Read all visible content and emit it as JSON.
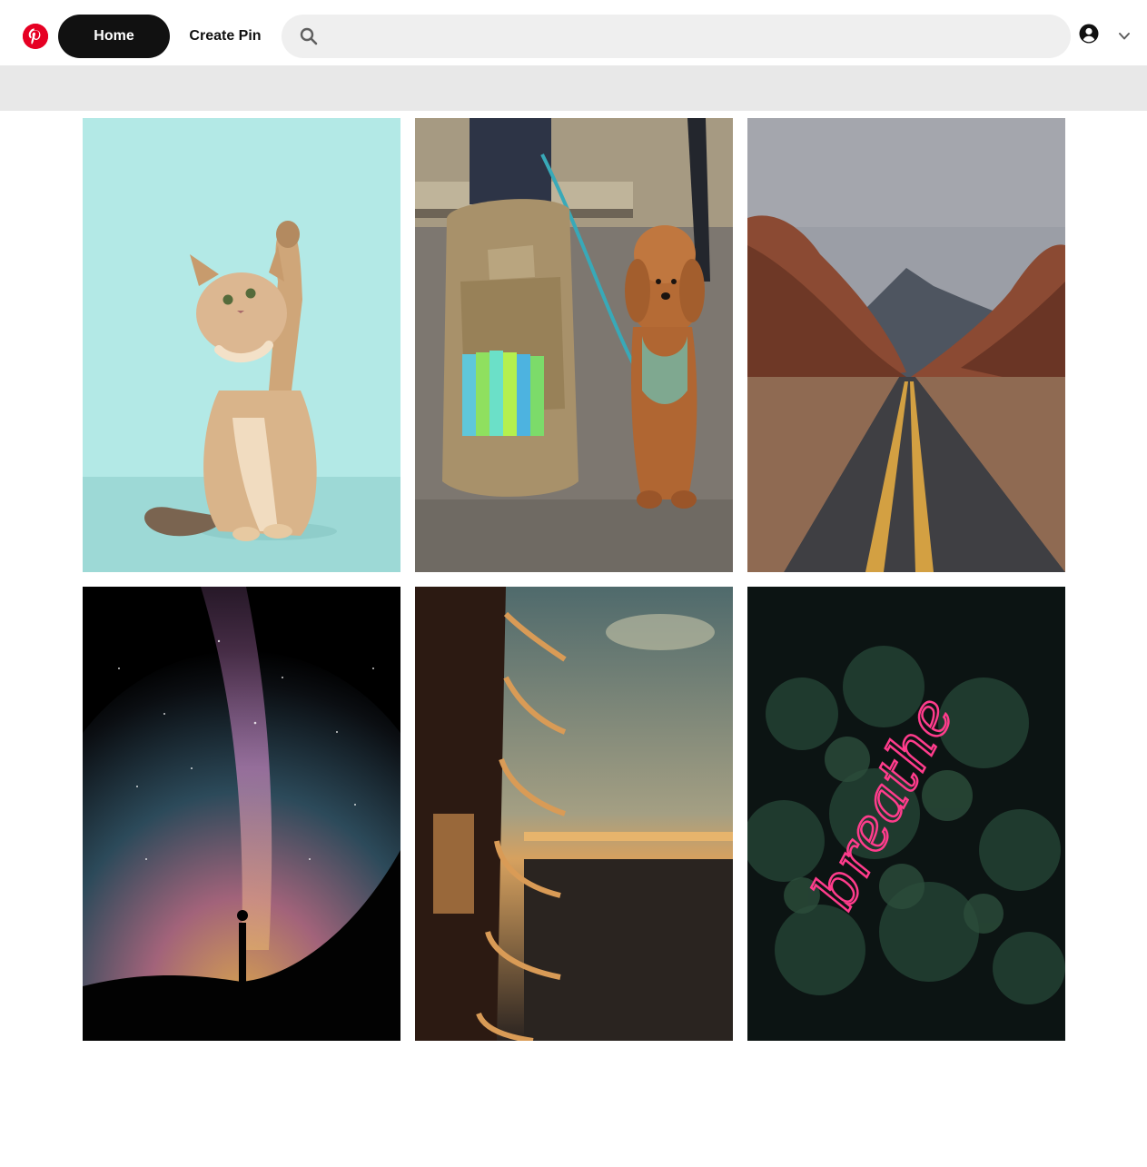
{
  "header": {
    "logo_icon": "pinterest-logo-icon",
    "nav": {
      "home_label": "Home",
      "create_pin_label": "Create Pin"
    },
    "search": {
      "icon": "search-icon",
      "placeholder": "",
      "value": ""
    },
    "account_icon": "user-circle-icon",
    "menu_icon": "chevron-down-icon",
    "colors": {
      "brand": "#e60023",
      "active_nav_bg": "#111111",
      "search_bg": "#efefef",
      "subbar_bg": "#e8e8e8"
    }
  },
  "pins": [
    {
      "subject": "kitten raising paw against teal background"
    },
    {
      "subject": "poodle next to disc golf backpack"
    },
    {
      "subject": "desert road through red rock canyon"
    },
    {
      "subject": "silhouette under milky way night sky"
    },
    {
      "subject": "curved balconies overlooking sea at sunset"
    },
    {
      "subject": "pink neon sign in foliage",
      "sign_text": "breathe"
    }
  ]
}
